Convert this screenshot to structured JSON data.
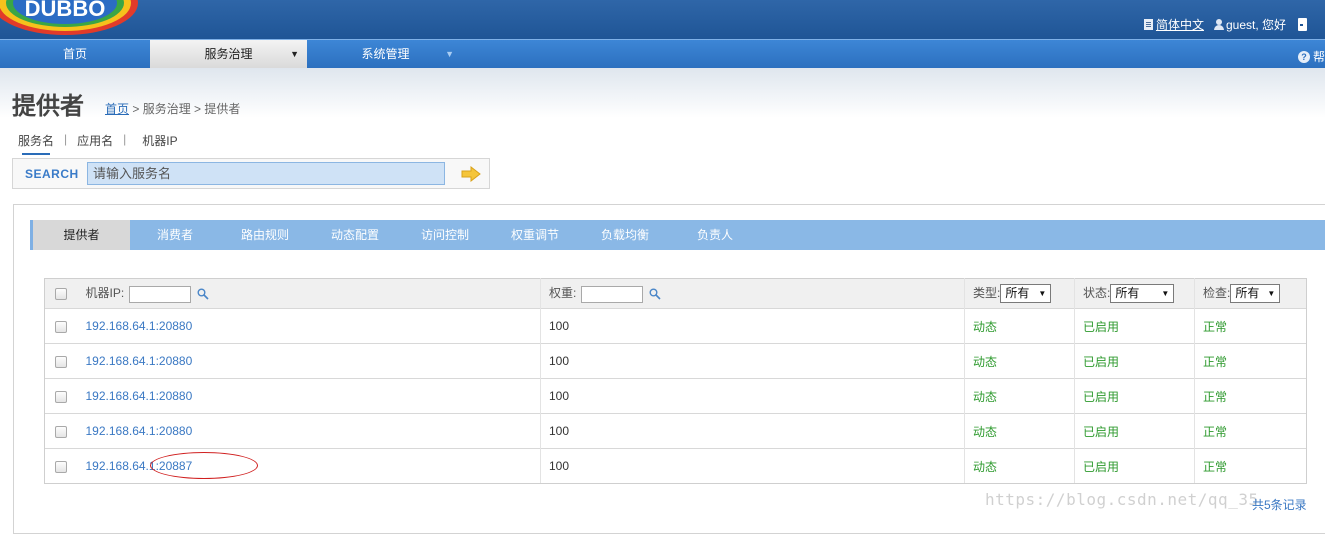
{
  "header": {
    "logo_text": "DUBBO",
    "language": "简体中文",
    "user": "guest, 您好"
  },
  "nav": {
    "items": [
      {
        "label": "首页"
      },
      {
        "label": "服务治理"
      },
      {
        "label": "系统管理"
      }
    ],
    "help": "帮"
  },
  "page": {
    "title": "提供者",
    "breadcrumb_home": "首页",
    "breadcrumb_rest": " > 服务治理 > 提供者"
  },
  "search": {
    "tabs": [
      "服务名",
      "应用名",
      "机器IP"
    ],
    "label": "SEARCH",
    "placeholder": "请输入服务名"
  },
  "tabs": [
    "提供者",
    "消费者",
    "路由规则",
    "动态配置",
    "访问控制",
    "权重调节",
    "负载均衡",
    "负责人"
  ],
  "table": {
    "headers": {
      "ip": "机器IP:",
      "weight": "权重:",
      "type": "类型:",
      "state": "状态:",
      "check": "检查:"
    },
    "filters": {
      "type": "所有",
      "state": "所有",
      "check": "所有"
    },
    "rows": [
      {
        "ip": "192.168.64.1:20880",
        "weight": "100",
        "type": "动态",
        "state": "已启用",
        "check": "正常"
      },
      {
        "ip": "192.168.64.1:20880",
        "weight": "100",
        "type": "动态",
        "state": "已启用",
        "check": "正常"
      },
      {
        "ip": "192.168.64.1:20880",
        "weight": "100",
        "type": "动态",
        "state": "已启用",
        "check": "正常"
      },
      {
        "ip": "192.168.64.1:20880",
        "weight": "100",
        "type": "动态",
        "state": "已启用",
        "check": "正常"
      },
      {
        "ip": "192.168.64.1:20887",
        "weight": "100",
        "type": "动态",
        "state": "已启用",
        "check": "正常"
      }
    ]
  },
  "footer": {
    "total": "共5条记录",
    "watermark": "https://blog.csdn.net/qq_35"
  },
  "colors": {
    "header_blue": "#1f5596",
    "nav_blue": "#2c70bf",
    "tab_bar": "#8ab8e6",
    "link": "#3a78c3",
    "status_green": "#2e9a2e",
    "annotation_red": "#d02020"
  }
}
